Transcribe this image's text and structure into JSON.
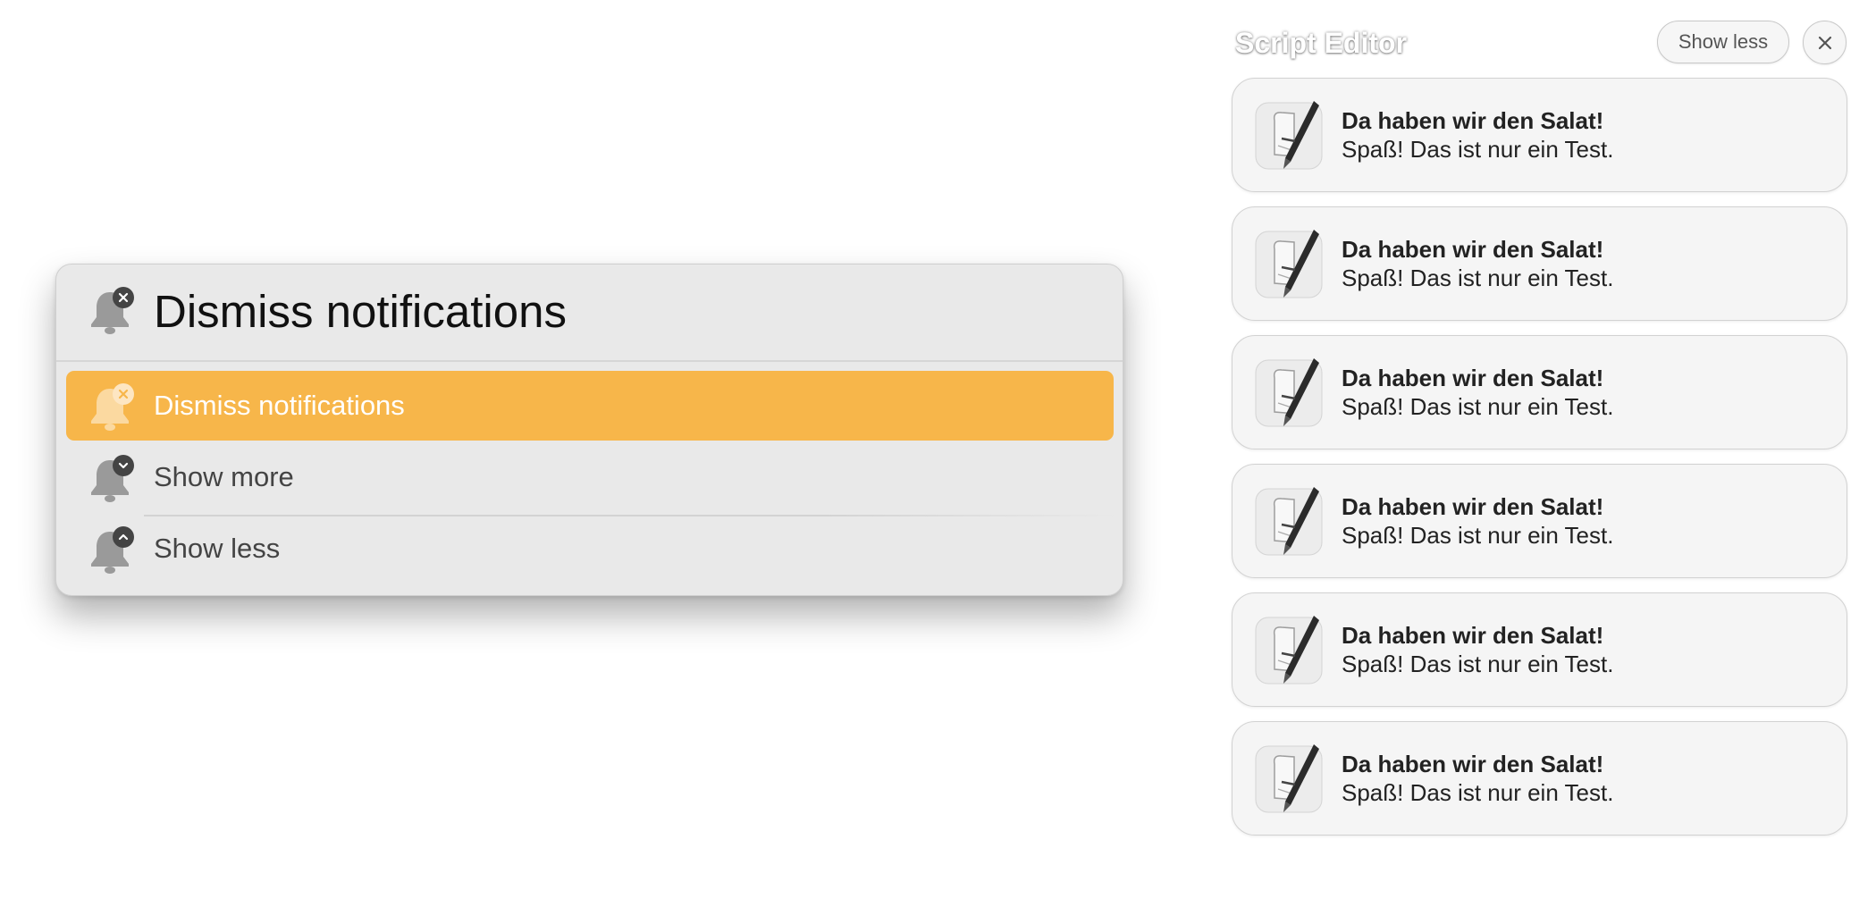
{
  "launcher": {
    "query": "Dismiss notifications",
    "results": [
      {
        "label": "Dismiss notifications",
        "icon": "bell-dismiss-icon",
        "selected": true
      },
      {
        "label": "Show more",
        "icon": "bell-show-more-icon",
        "selected": false
      },
      {
        "label": "Show less",
        "icon": "bell-show-less-icon",
        "selected": false
      }
    ],
    "accent_color": "#f7b64a"
  },
  "notification_center": {
    "app_name": "Script Editor",
    "show_less_label": "Show less",
    "close_icon": "close-icon",
    "notifications": [
      {
        "title": "Da haben wir den Salat!",
        "body": "Spaß! Das ist nur ein Test.",
        "icon": "script-editor-app-icon"
      },
      {
        "title": "Da haben wir den Salat!",
        "body": "Spaß! Das ist nur ein Test.",
        "icon": "script-editor-app-icon"
      },
      {
        "title": "Da haben wir den Salat!",
        "body": "Spaß! Das ist nur ein Test.",
        "icon": "script-editor-app-icon"
      },
      {
        "title": "Da haben wir den Salat!",
        "body": "Spaß! Das ist nur ein Test.",
        "icon": "script-editor-app-icon"
      },
      {
        "title": "Da haben wir den Salat!",
        "body": "Spaß! Das ist nur ein Test.",
        "icon": "script-editor-app-icon"
      },
      {
        "title": "Da haben wir den Salat!",
        "body": "Spaß! Das ist nur ein Test.",
        "icon": "script-editor-app-icon"
      }
    ]
  }
}
